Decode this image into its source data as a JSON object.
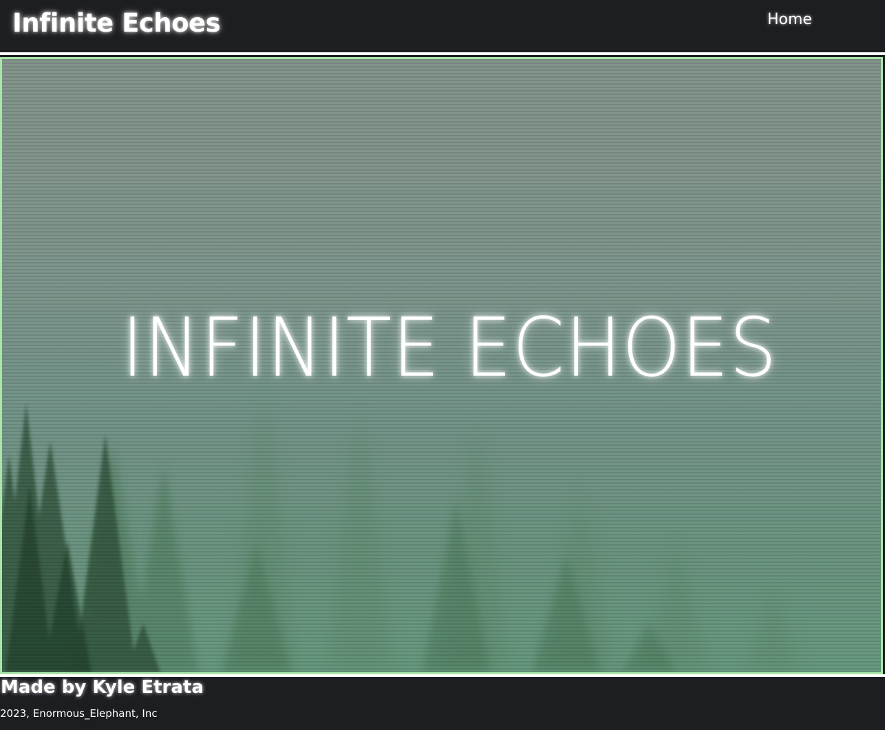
{
  "header": {
    "site_title": "Infinite Echoes",
    "nav": {
      "home_label": "Home"
    }
  },
  "hero": {
    "heading": "INFINITE ECHOES",
    "background": "misty-forest-image"
  },
  "footer": {
    "credit": "Made by Kyle Etrata",
    "copyright": "2023, Enormous_Elephant, Inc"
  },
  "colors": {
    "page_background": "#1d1e22",
    "hero_border": "#a8e6a8",
    "text": "#ffffff"
  }
}
